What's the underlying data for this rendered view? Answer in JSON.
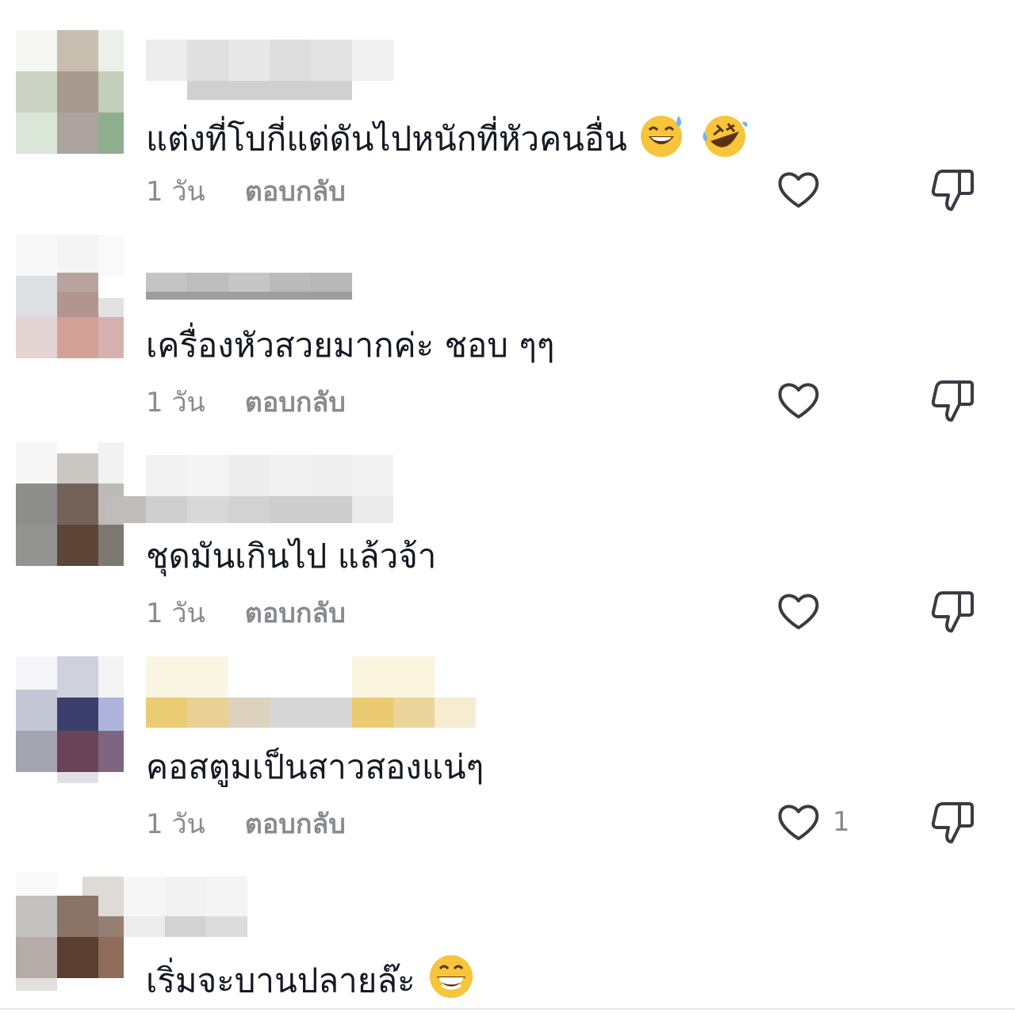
{
  "comments": [
    {
      "text": "แต่งที่โบกี่แต่ดันไปหนักที่หัวคนอื่น",
      "emojis": [
        "sweat-smile-emoji",
        "rofl-emoji"
      ],
      "time": "1 วัน",
      "reply": "ตอบกลับ",
      "likes": ""
    },
    {
      "text": "เครื่องหัวสวยมากค่ะ ชอบ ๆๆ",
      "emojis": [],
      "time": "1 วัน",
      "reply": "ตอบกลับ",
      "likes": ""
    },
    {
      "text": "ชุดมันเกินไป แล้วจ้า",
      "emojis": [],
      "time": "1 วัน",
      "reply": "ตอบกลับ",
      "likes": ""
    },
    {
      "text": "คอสตูมเป็นสาวสองแน่ๆ",
      "emojis": [],
      "time": "1 วัน",
      "reply": "ตอบกลับ",
      "likes": "1"
    },
    {
      "text": "เริ่มจะบานปลายล๊ะ",
      "emojis": [
        "grinning-emoji"
      ],
      "time": "",
      "reply": "",
      "likes": ""
    }
  ],
  "colors": {
    "text": "#161823",
    "muted": "#8a8b91",
    "icon": "#3a3b42"
  }
}
